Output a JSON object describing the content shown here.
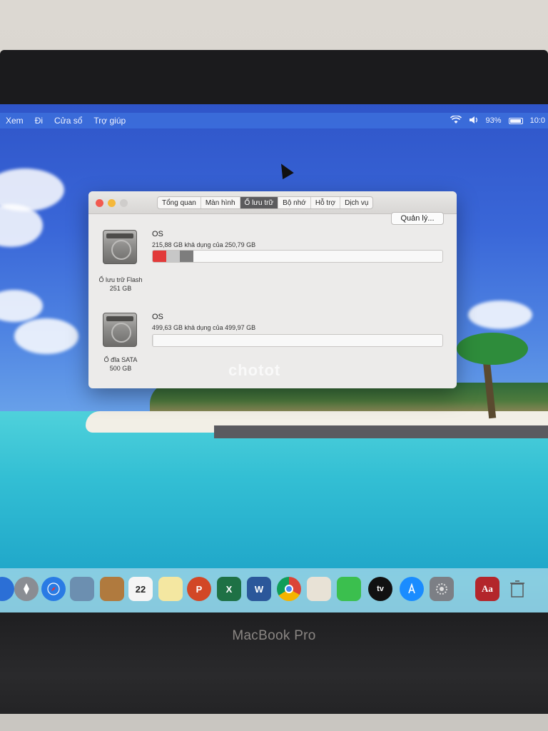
{
  "menubar": {
    "items": [
      "Xem",
      "Đi",
      "Cửa sổ",
      "Trợ giúp"
    ],
    "battery": "93%",
    "clock": "10:0"
  },
  "window": {
    "tabs": [
      {
        "label": "Tổng quan",
        "active": false
      },
      {
        "label": "Màn hình",
        "active": false
      },
      {
        "label": "Ổ lưu trữ",
        "active": true
      },
      {
        "label": "Bộ nhớ",
        "active": false
      },
      {
        "label": "Hỗ trợ",
        "active": false
      },
      {
        "label": "Dịch vụ",
        "active": false
      }
    ],
    "drives": [
      {
        "type_label": "Ổ lưu trữ Flash",
        "capacity_label": "251 GB",
        "volume_name": "OS",
        "availability": "215,88 GB khả dụng của 250,79 GB",
        "used_fraction": 0.14,
        "segment_colors": [
          "#e23a3a",
          "#c7c7c7",
          "#7d7d7d"
        ]
      },
      {
        "type_label": "Ổ đĩa SATA",
        "capacity_label": "500 GB",
        "volume_name": "OS",
        "availability": "499,63 GB khả dụng của 499,97 GB",
        "used_fraction": 0.001,
        "segment_colors": [
          "#dddddd"
        ]
      }
    ],
    "manage_button": "Quản lý..."
  },
  "watermark": "chotot",
  "dock": {
    "icons": [
      "launchpad-icon",
      "safari-icon",
      "preview-icon",
      "notes-icon",
      "calendar-icon",
      "stickies-icon",
      "powerpoint-icon",
      "excel-icon",
      "word-icon",
      "chrome-icon",
      "paintbrush-icon",
      "facetime-icon",
      "apple-tv-icon",
      "app-store-icon",
      "system-preferences-icon",
      "dictionary-icon",
      "trash-icon"
    ],
    "calendar_day": "22",
    "appletv_label": "tv",
    "dictionary_label": "Aa"
  },
  "laptop": {
    "brand": "MacBook Pro"
  },
  "colors": {
    "menubar": "#3c6edc",
    "active_tab": "#5b5b5d",
    "used_segment": "#e23a3a"
  }
}
